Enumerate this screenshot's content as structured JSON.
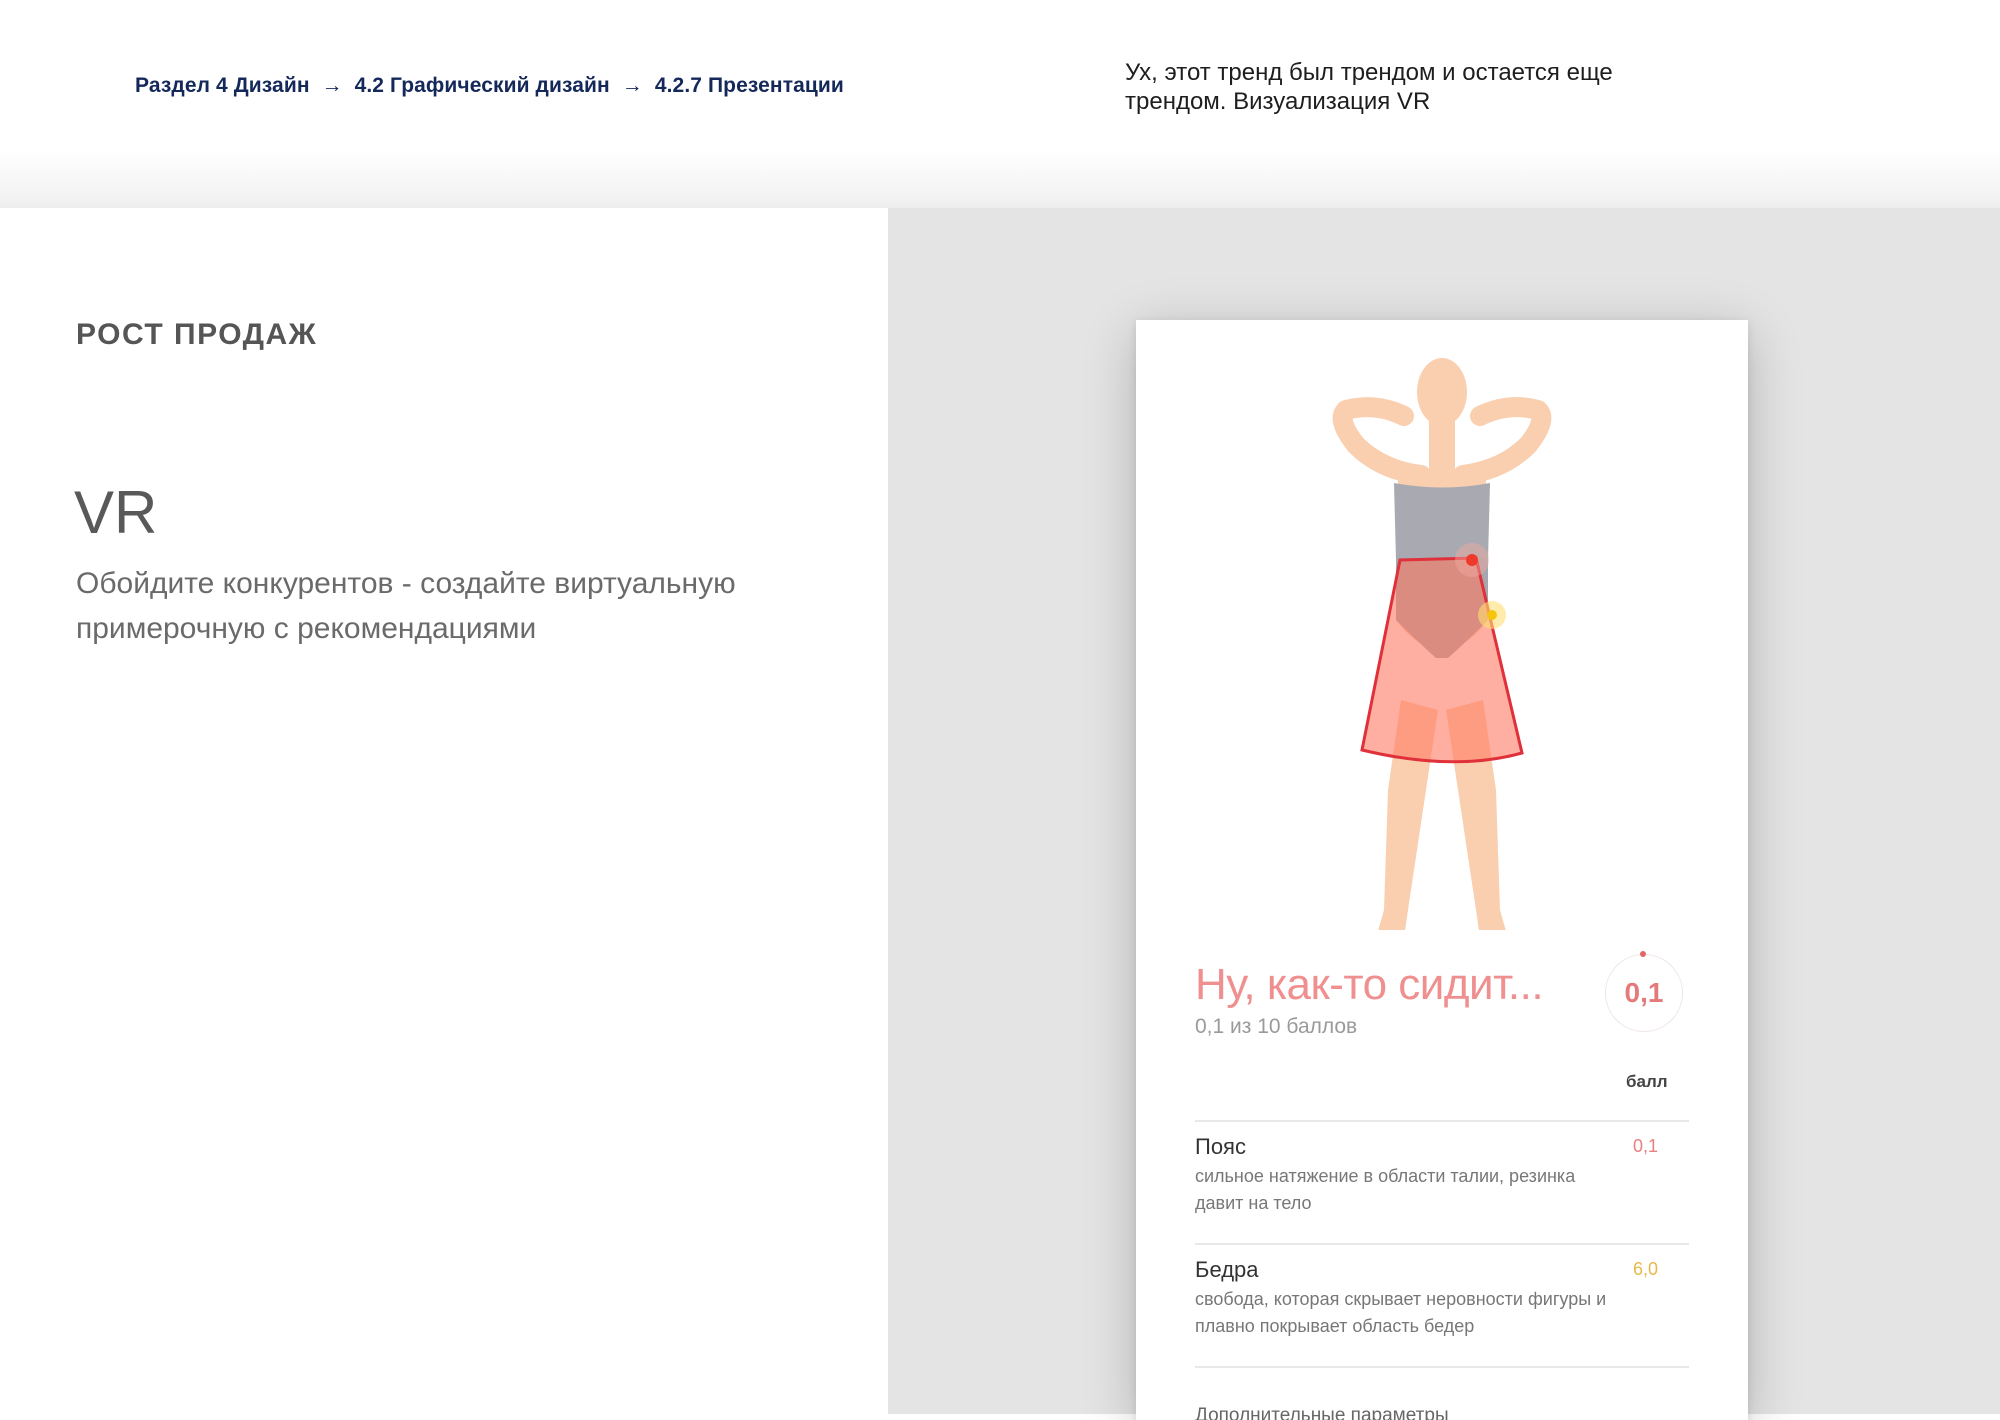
{
  "header": {
    "breadcrumb": {
      "part1": "Раздел 4 Дизайн",
      "arrow": "→",
      "part2": "4.2 Графический дизайн",
      "part3": "4.2.7 Презентации"
    },
    "note": "Ух, этот тренд был трендом и остается еще трендом. Визуализация VR"
  },
  "left": {
    "section_title": "РОСТ ПРОДАЖ",
    "heading": "VR",
    "description": "Обойдите конкурентов - создайте виртуальную примерочную с рекомендациями"
  },
  "phone": {
    "figure_icon": "woman-in-skirt-illustration",
    "verdict": "Ну, как-то сидит...",
    "score_subtitle": "0,1 из 10 баллов",
    "score_value": "0,1",
    "score_unit": "балл",
    "params": [
      {
        "name": "Пояс",
        "description": "сильное натяжение в области талии, резинка давит на тело",
        "score": "0,1",
        "color": "#e88080"
      },
      {
        "name": "Бедра",
        "description": "свобода, которая скрывает неровности фигуры и плавно покрывает область бедер",
        "score": "6,0",
        "color": "#e8b84a"
      }
    ],
    "extra_label": "Дополнительные параметры"
  }
}
